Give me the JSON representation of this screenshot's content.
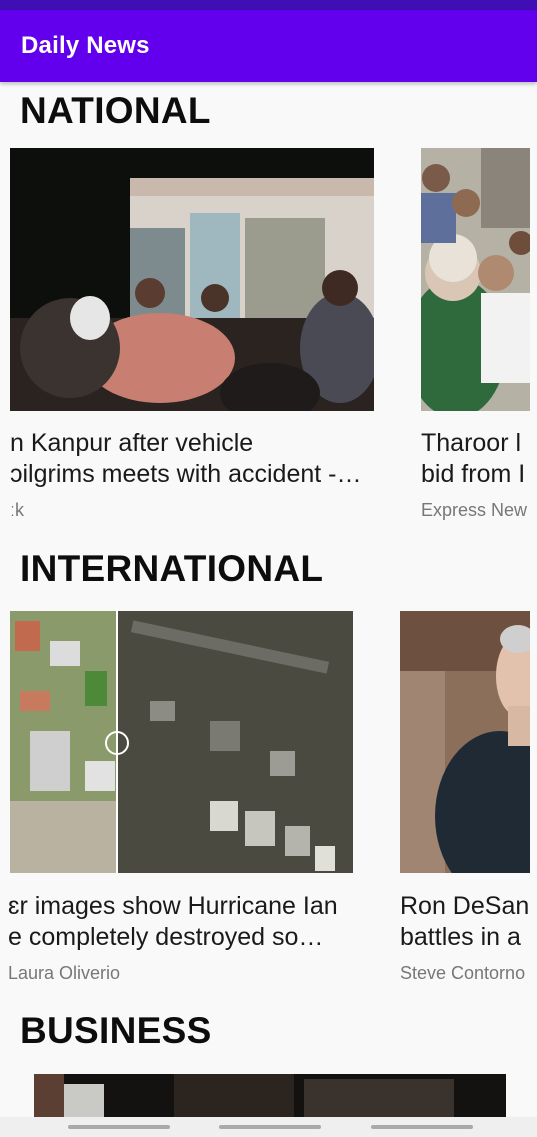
{
  "app": {
    "title": "Daily News"
  },
  "sections": [
    {
      "title": "NATIONAL",
      "cards": [
        {
          "headline_line1": "n Kanpur after vehicle",
          "headline_line2": "ɔilgrims meets with accident -…",
          "source": "ːk"
        },
        {
          "headline_line1": "Tharoor l",
          "headline_line2": "bid from I",
          "source": "Express New"
        }
      ]
    },
    {
      "title": "INTERNATIONAL",
      "cards": [
        {
          "headline_line1": "ɛr images show Hurricane Ian",
          "headline_line2": "e completely destroyed so…",
          "source": "Laura Oliverio"
        },
        {
          "headline_line1": "Ron DeSan",
          "headline_line2": "battles in a",
          "source": "Steve Contorno"
        }
      ]
    },
    {
      "title": "BUSINESS"
    }
  ]
}
